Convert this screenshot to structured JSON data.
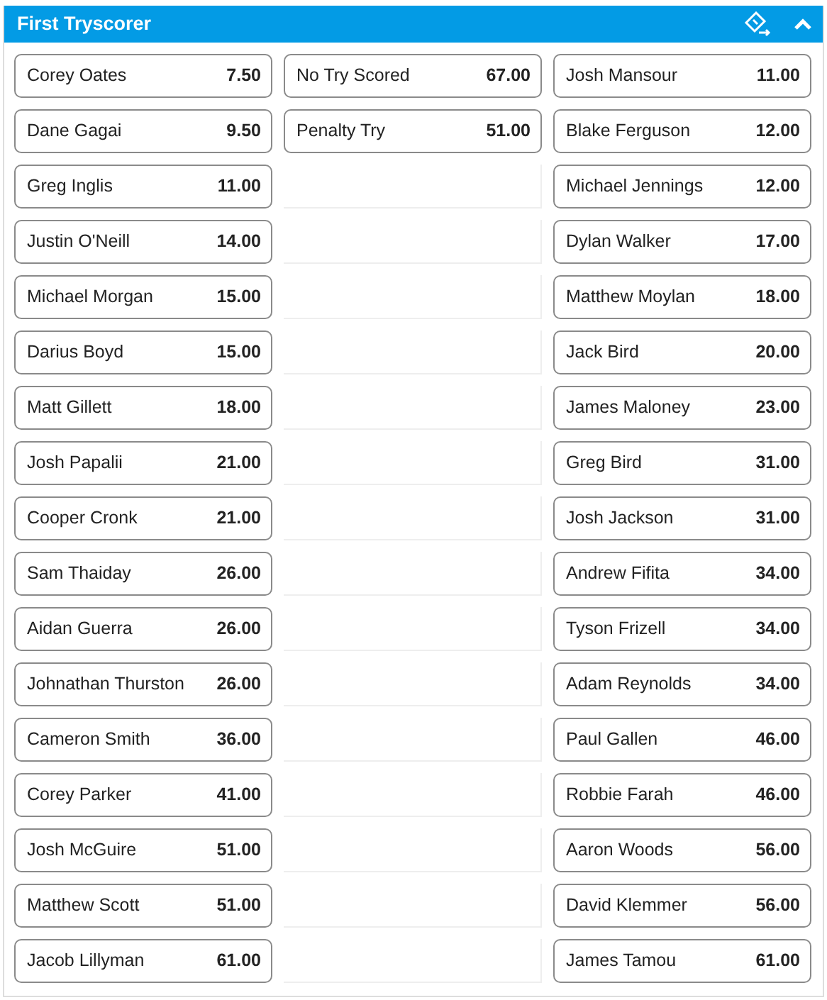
{
  "market": {
    "title": "First Tryscorer",
    "expanded": true
  },
  "columns": [
    [
      {
        "name": "Corey Oates",
        "odds": "7.50"
      },
      {
        "name": "Dane Gagai",
        "odds": "9.50"
      },
      {
        "name": "Greg Inglis",
        "odds": "11.00"
      },
      {
        "name": "Justin O'Neill",
        "odds": "14.00"
      },
      {
        "name": "Michael Morgan",
        "odds": "15.00"
      },
      {
        "name": "Darius Boyd",
        "odds": "15.00"
      },
      {
        "name": "Matt Gillett",
        "odds": "18.00"
      },
      {
        "name": "Josh Papalii",
        "odds": "21.00"
      },
      {
        "name": "Cooper Cronk",
        "odds": "21.00"
      },
      {
        "name": "Sam Thaiday",
        "odds": "26.00"
      },
      {
        "name": "Aidan Guerra",
        "odds": "26.00"
      },
      {
        "name": "Johnathan Thurston",
        "odds": "26.00"
      },
      {
        "name": "Cameron Smith",
        "odds": "36.00"
      },
      {
        "name": "Corey Parker",
        "odds": "41.00"
      },
      {
        "name": "Josh McGuire",
        "odds": "51.00"
      },
      {
        "name": "Matthew Scott",
        "odds": "51.00"
      },
      {
        "name": "Jacob Lillyman",
        "odds": "61.00"
      }
    ],
    [
      {
        "name": "No Try Scored",
        "odds": "67.00"
      },
      {
        "name": "Penalty Try",
        "odds": "51.00"
      }
    ],
    [
      {
        "name": "Josh Mansour",
        "odds": "11.00"
      },
      {
        "name": "Blake Ferguson",
        "odds": "12.00"
      },
      {
        "name": "Michael Jennings",
        "odds": "12.00"
      },
      {
        "name": "Dylan Walker",
        "odds": "17.00"
      },
      {
        "name": "Matthew Moylan",
        "odds": "18.00"
      },
      {
        "name": "Jack Bird",
        "odds": "20.00"
      },
      {
        "name": "James Maloney",
        "odds": "23.00"
      },
      {
        "name": "Greg Bird",
        "odds": "31.00"
      },
      {
        "name": "Josh Jackson",
        "odds": "31.00"
      },
      {
        "name": "Andrew Fifita",
        "odds": "34.00"
      },
      {
        "name": "Tyson Frizell",
        "odds": "34.00"
      },
      {
        "name": "Adam Reynolds",
        "odds": "34.00"
      },
      {
        "name": "Paul Gallen",
        "odds": "46.00"
      },
      {
        "name": "Robbie Farah",
        "odds": "46.00"
      },
      {
        "name": "Aaron Woods",
        "odds": "56.00"
      },
      {
        "name": "David Klemmer",
        "odds": "56.00"
      },
      {
        "name": "James Tamou",
        "odds": "61.00"
      }
    ]
  ]
}
